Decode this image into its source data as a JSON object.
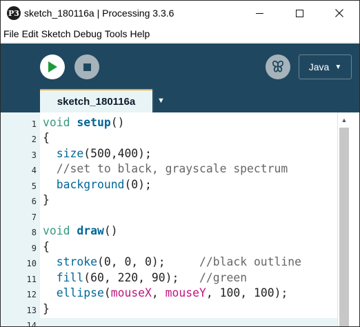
{
  "window": {
    "title": "sketch_180116a | Processing 3.3.6",
    "app_icon": "P3"
  },
  "menubar": {
    "items": [
      "File",
      "Edit",
      "Sketch",
      "Debug",
      "Tools",
      "Help"
    ]
  },
  "toolbar": {
    "run_icon": "play-icon",
    "stop_icon": "stop-icon",
    "debugger_icon": "butterfly-icon",
    "mode": "Java",
    "mode_arrow": "▼"
  },
  "tabs": {
    "active": "sketch_180116a",
    "menu_arrow": "▼"
  },
  "editor": {
    "line_numbers": [
      "1",
      "2",
      "3",
      "4",
      "5",
      "6",
      "7",
      "8",
      "9",
      "10",
      "11",
      "12",
      "13",
      "14"
    ],
    "line1": {
      "type": "void",
      "name": "setup",
      "rest": "()"
    },
    "line2": "{",
    "line3": {
      "fn": "size",
      "args": "(500,400);"
    },
    "line4": "//set to black, grayscale spectrum",
    "line5": {
      "fn": "background",
      "args": "(0);"
    },
    "line6": "}",
    "line8": {
      "type": "void",
      "name": "draw",
      "rest": "()"
    },
    "line9": "{",
    "line10": {
      "fn": "stroke",
      "args": "(0, 0, 0);",
      "comment": "//black outline"
    },
    "line11": {
      "fn": "fill",
      "args": "(60, 220, 90);",
      "comment": "//green"
    },
    "line12": {
      "fn": "ellipse",
      "open": "(",
      "var1": "mouseX",
      "sep": ", ",
      "var2": "mouseY",
      "args": ", 100, 100);"
    },
    "line13": "}"
  },
  "colors": {
    "toolbar_bg": "#1f4860",
    "tab_accent": "#f0a81d",
    "keyword_type": "#33997e",
    "keyword_fn": "#006699",
    "variable": "#c0147d",
    "comment": "#666666"
  }
}
